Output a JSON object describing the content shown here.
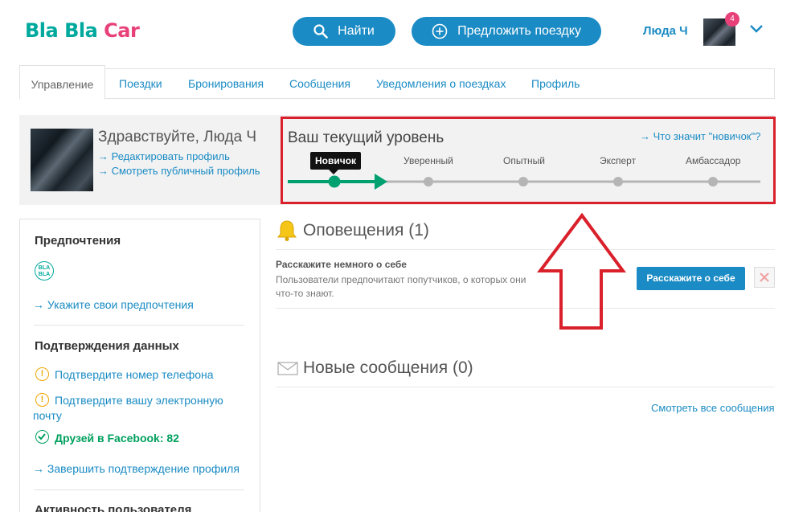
{
  "brand": {
    "part1": "Bla",
    "part2": "Bla",
    "part3": "Car",
    "teal": "#00a99d",
    "pink": "#e8417a"
  },
  "header": {
    "find_label": "Найти",
    "offer_label": "Предложить поездку",
    "user_name": "Люда Ч",
    "notifications_badge": "4",
    "accent": "#1a8bc4"
  },
  "tabs": [
    {
      "label": "Управление",
      "active": true
    },
    {
      "label": "Поездки"
    },
    {
      "label": "Бронирования"
    },
    {
      "label": "Сообщения"
    },
    {
      "label": "Уведомления о поездках"
    },
    {
      "label": "Профиль"
    }
  ],
  "greeting": {
    "hello": "Здравствуйте, Люда Ч",
    "edit_profile": "→ Редактировать профиль",
    "public_profile": "→ Смотреть публичный профиль"
  },
  "level": {
    "title": "Ваш текущий уровень",
    "help_link": "→ Что значит \"новичок\"?",
    "current_index": 0,
    "steps": [
      "Новичок",
      "Уверенный",
      "Опытный",
      "Эксперт",
      "Амбассадор"
    ],
    "active_color": "#00a070",
    "inactive_color": "#b5b5b5",
    "highlight_color": "#d9202b"
  },
  "sidebar": {
    "preferences_title": "Предпочтения",
    "bla_badge_line1": "BLA",
    "bla_badge_line2": "BLA",
    "preferences_link": "→ Укажите свои предпочтения",
    "verification_title": "Подтверждения данных",
    "verify_phone": "Подтвердите номер телефона",
    "verify_email_1": "Подтвердите вашу электронную",
    "verify_email_2": "почту",
    "facebook_friends": "Друзей в Facebook: 82",
    "finish_verification": "→ Завершить подтверждение профиля",
    "activity_title": "Активность пользователя"
  },
  "alerts": {
    "title": "Оповещения (1)",
    "item_title": "Расскажите немного о себе",
    "item_text": "Пользователи предпочитают попутчиков, о которых они что-то знают.",
    "tell_button": "Расскажите о себе"
  },
  "messages": {
    "title": "Новые сообщения (0)",
    "see_all": "Смотреть все сообщения"
  }
}
